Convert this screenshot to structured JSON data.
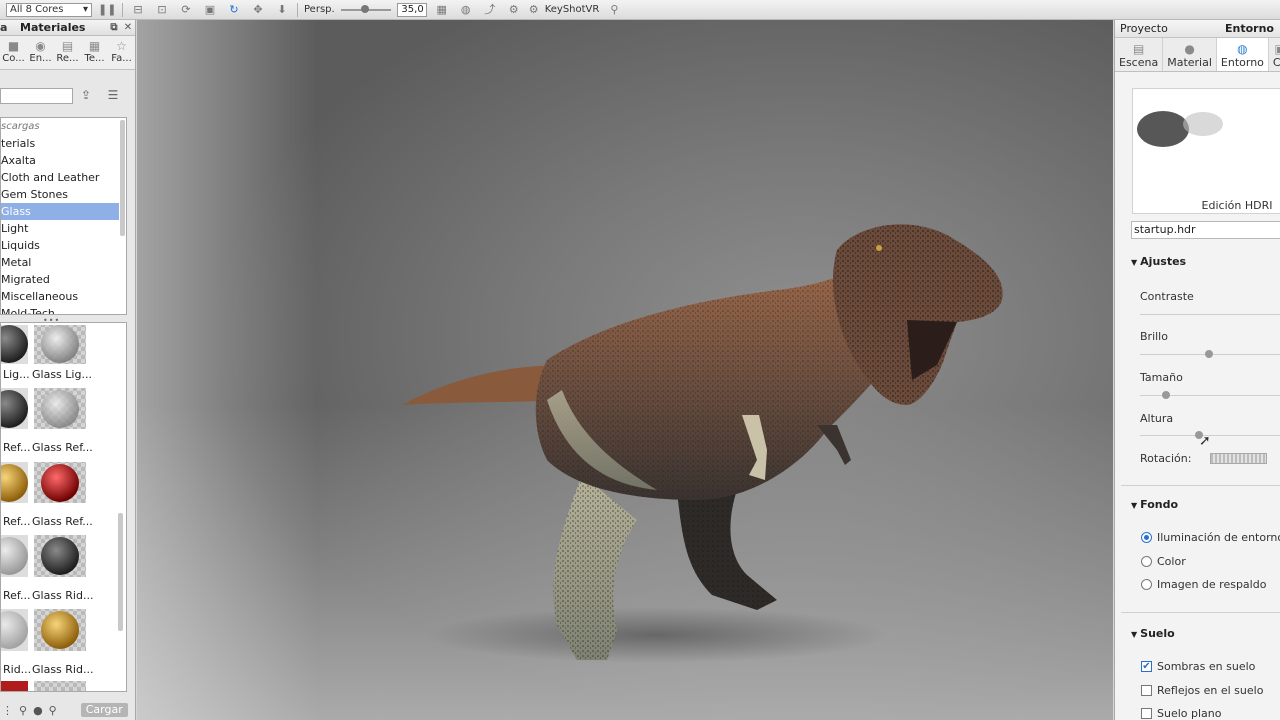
{
  "toolbar": {
    "cores_select": "All 8 Cores",
    "perspective_label": "Persp.",
    "perspective_value": "35,0",
    "keyshotvr_label": "KeyShotVR"
  },
  "library": {
    "title_partial": "a",
    "title": "Materiales",
    "tabs": [
      {
        "label": "Co..."
      },
      {
        "label": "En..."
      },
      {
        "label": "Re..."
      },
      {
        "label": "Te..."
      },
      {
        "label": "Fa..."
      }
    ],
    "tree": [
      {
        "label": "scargas"
      },
      {
        "label": "terials"
      },
      {
        "label": "Axalta"
      },
      {
        "label": "Cloth and Leather"
      },
      {
        "label": "Gem Stones"
      },
      {
        "label": "Glass"
      },
      {
        "label": "Light"
      },
      {
        "label": "Liquids"
      },
      {
        "label": "Metal"
      },
      {
        "label": "Migrated"
      },
      {
        "label": "Miscellaneous"
      },
      {
        "label": "Mold-Tech"
      }
    ],
    "thumbnails": [
      {
        "left_label": "Lig...",
        "right_label": "Glass Lig..."
      },
      {
        "left_label": "Ref...",
        "right_label": "Glass Ref..."
      },
      {
        "left_label": "Ref...",
        "right_label": "Glass Ref..."
      },
      {
        "left_label": "Ref...",
        "right_label": "Glass Rid..."
      },
      {
        "left_label": "Rid...",
        "right_label": "Glass Rid..."
      }
    ],
    "load_button": "Cargar"
  },
  "props": {
    "header_left": "Proyecto",
    "header_right": "Entorno",
    "tabs": [
      {
        "label": "Escena"
      },
      {
        "label": "Material"
      },
      {
        "label": "Entorno"
      },
      {
        "label": "Cá"
      }
    ],
    "hdri_caption": "Edición HDRI",
    "file": "startup.hdr",
    "ajustes_title": "Ajustes",
    "contraste": "Contraste",
    "brillo": "Brillo",
    "tamano": "Tamaño",
    "altura": "Altura",
    "rotacion": "Rotación:",
    "fondo_title": "Fondo",
    "fondo_options": [
      "Iluminación de entorno",
      "Color",
      "Imagen de respaldo"
    ],
    "suelo_title": "Suelo",
    "suelo_options": [
      "Sombras en suelo",
      "Reflejos en el suelo",
      "Suelo plano"
    ]
  },
  "colors": {
    "accent": "#2a6fd0",
    "selection": "#8fb0e6"
  }
}
